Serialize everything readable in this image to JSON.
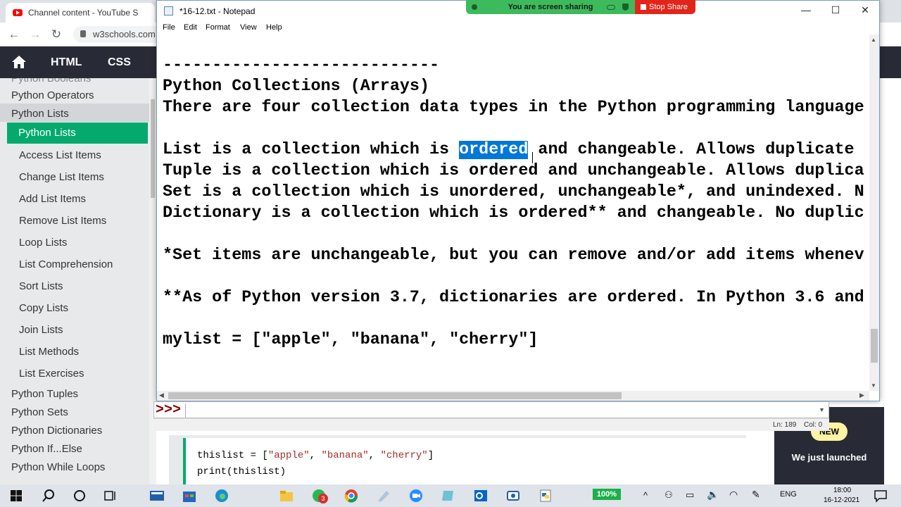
{
  "browser": {
    "tab_title": "Channel content - YouTube S",
    "url": "w3schools.com"
  },
  "w3nav": {
    "items": [
      "HTML",
      "CSS"
    ]
  },
  "sidebar": {
    "partial_top": "Python Booleans",
    "operators": "Python Operators",
    "lists": "Python Lists",
    "current": "Python Lists",
    "sub_items": [
      "Access List Items",
      "Change List Items",
      "Add List Items",
      "Remove List Items",
      "Loop Lists",
      "List Comprehension",
      "Sort Lists",
      "Copy Lists",
      "Join Lists",
      "List Methods",
      "List Exercises"
    ],
    "after_items": [
      "Python Tuples",
      "Python Sets",
      "Python Dictionaries",
      "Python If...Else",
      "Python While Loops"
    ]
  },
  "notepad": {
    "title": "*16-12.txt - Notepad",
    "menu": [
      "File",
      "Edit",
      "Format",
      "View",
      "Help"
    ],
    "lines": {
      "divider": "----------------------------",
      "heading": "Python Collections (Arrays)",
      "intro": "There are four collection data types in the Python programming language",
      "list_before": "List is a collection which is ",
      "list_selected": "ordered",
      "list_after": " and changeable. Allows duplicate ",
      "tuple": "Tuple is a collection which is ordered and unchangeable. Allows duplica",
      "set": "Set is a collection which is unordered, unchangeable*, and unindexed. N",
      "dict": "Dictionary is a collection which is ordered** and changeable. No duplic",
      "note1": "*Set items are unchangeable, but you can remove and/or add items whenev",
      "note2": "**As of Python version 3.7, dictionaries are ordered. In Python 3.6 and",
      "code": "mylist = [\"apple\", \"banana\", \"cherry\"]"
    }
  },
  "screen_share": {
    "status": "You are screen sharing",
    "stop_label": "Stop Share"
  },
  "idle": {
    "prompt": ">>>",
    "line": "Ln: 189",
    "col": "Col: 0"
  },
  "example": {
    "code_line1_start": "thislist = [",
    "code_line1_s1": "\"apple\"",
    "code_line1_s2": "\"banana\"",
    "code_line1_s3": "\"cherry\"",
    "code_line2": "print(thislist)"
  },
  "promo": {
    "badge": "NEW",
    "text": "We just launched"
  },
  "taskbar": {
    "battery": "100%",
    "language": "ENG",
    "time": "18:00",
    "date": "16-12-2021",
    "whatsapp_badge": "3"
  }
}
